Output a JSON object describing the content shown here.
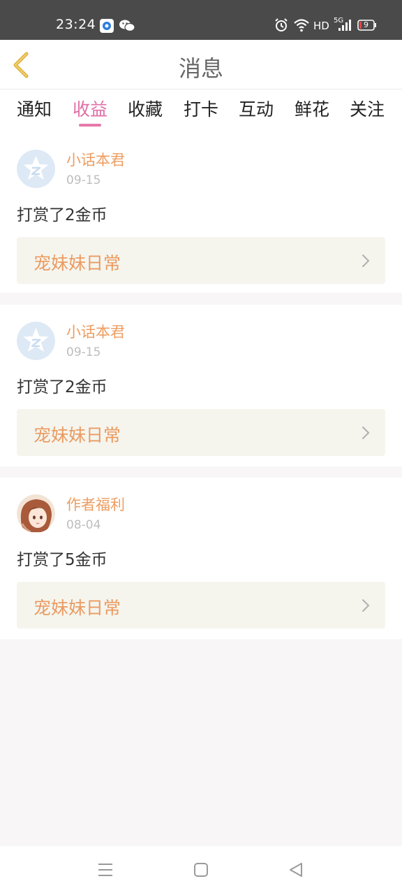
{
  "status_bar": {
    "time": "23:24",
    "network": "HD",
    "signal": "5G",
    "battery": "9",
    "icons": [
      "app-icon",
      "wechat-icon",
      "alarm-icon",
      "wifi-icon",
      "signal-icon",
      "battery-icon"
    ]
  },
  "header": {
    "title": "消息",
    "back_icon": "chevron-left-icon"
  },
  "tabs": [
    {
      "label": "通知"
    },
    {
      "label": "收益"
    },
    {
      "label": "收藏"
    },
    {
      "label": "打卡"
    },
    {
      "label": "互动"
    },
    {
      "label": "鲜花"
    },
    {
      "label": "关注"
    }
  ],
  "active_tab": "收益",
  "messages": [
    {
      "user": "小话本君",
      "date": "09-15",
      "text": "打赏了2金币",
      "book": "宠妹妹日常",
      "avatar": "star-logo-avatar"
    },
    {
      "user": "小话本君",
      "date": "09-15",
      "text": "打赏了2金币",
      "book": "宠妹妹日常",
      "avatar": "star-logo-avatar"
    },
    {
      "user": "作者福利",
      "date": "08-04",
      "text": "打赏了5金币",
      "book": "宠妹妹日常",
      "avatar": "anime-girl-avatar"
    }
  ],
  "colors": {
    "accent_pink": "#e06fa6",
    "name_orange": "#ee9d61",
    "book_bg": "#f5f5ee",
    "back_icon": "#e0b23a"
  },
  "nav_bar": [
    "menu-icon",
    "home-icon",
    "back-icon"
  ]
}
